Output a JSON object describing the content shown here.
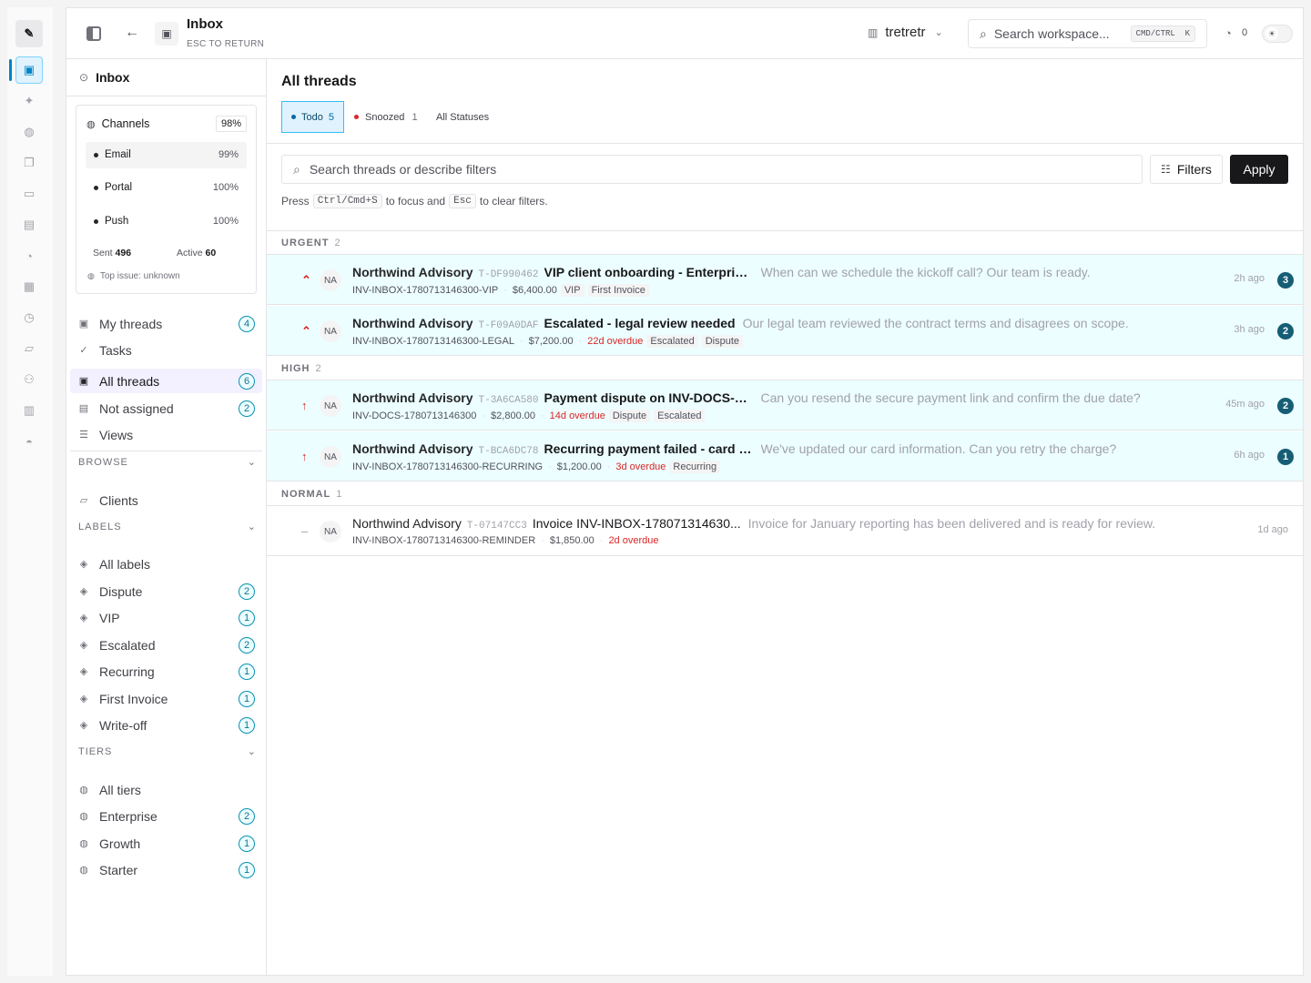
{
  "header": {
    "title": "Inbox",
    "subtitle": "ESC TO RETURN",
    "workspace": "tretretr",
    "search_placeholder": "Search workspace...",
    "shortcut": "CMD/CTRL  K",
    "notif_count": "0"
  },
  "sidebar": {
    "title": "Inbox",
    "channels": {
      "label": "Channels",
      "pct": "98%",
      "items": [
        {
          "label": "Email",
          "pct": "99%"
        },
        {
          "label": "Portal",
          "pct": "100%"
        },
        {
          "label": "Push",
          "pct": "100%"
        }
      ],
      "sent_label": "Sent",
      "sent": "496",
      "active_label": "Active",
      "active": "60",
      "top_issue": "Top issue: unknown"
    },
    "nav": [
      {
        "label": "My threads",
        "count": "4"
      },
      {
        "label": "Tasks",
        "count": ""
      },
      {
        "label": "All threads",
        "count": "6"
      },
      {
        "label": "Not assigned",
        "count": "2"
      },
      {
        "label": "Views",
        "count": ""
      }
    ],
    "browse": {
      "heading": "BROWSE",
      "items": [
        {
          "label": "Clients"
        }
      ]
    },
    "labels": {
      "heading": "LABELS",
      "items": [
        {
          "label": "All labels",
          "count": ""
        },
        {
          "label": "Dispute",
          "count": "2"
        },
        {
          "label": "VIP",
          "count": "1"
        },
        {
          "label": "Escalated",
          "count": "2"
        },
        {
          "label": "Recurring",
          "count": "1"
        },
        {
          "label": "First Invoice",
          "count": "1"
        },
        {
          "label": "Write-off",
          "count": "1"
        }
      ]
    },
    "tiers": {
      "heading": "TIERS",
      "items": [
        {
          "label": "All tiers",
          "count": ""
        },
        {
          "label": "Enterprise",
          "count": "2"
        },
        {
          "label": "Growth",
          "count": "1"
        },
        {
          "label": "Starter",
          "count": "1"
        }
      ]
    }
  },
  "main": {
    "title": "All threads",
    "tabs": [
      {
        "label": "Todo",
        "count": "5"
      },
      {
        "label": "Snoozed",
        "count": "1"
      },
      {
        "label": "All Statuses",
        "count": ""
      }
    ],
    "search_placeholder": "Search threads or describe filters",
    "filters_label": "Filters",
    "apply_label": "Apply",
    "hint": {
      "press": "Press",
      "k1": "Ctrl/Cmd+S",
      "mid": "to focus and",
      "k2": "Esc",
      "end": "to clear filters."
    },
    "groups": [
      {
        "label": "URGENT",
        "count": "2"
      },
      {
        "label": "HIGH",
        "count": "2"
      },
      {
        "label": "NORMAL",
        "count": "1"
      }
    ],
    "rows": [
      {
        "prio": "⌃",
        "avatar": "NA",
        "client": "Northwind Advisory",
        "tid": "T-DF990462",
        "subject": "VIP client onboarding - Enterprise...",
        "preview": "When can we schedule the kickoff call? Our team is ready.",
        "invoice": "INV-INBOX-1780713146300-VIP",
        "amount": "$6,400.00",
        "overdue": "",
        "tags": [
          "VIP",
          "First Invoice"
        ],
        "time": "2h ago",
        "badge": "3"
      },
      {
        "prio": "⌃",
        "avatar": "NA",
        "client": "Northwind Advisory",
        "tid": "T-F09A0DAF",
        "subject": "Escalated - legal review needed",
        "preview": "Our legal team reviewed the contract terms and disagrees on scope.",
        "invoice": "INV-INBOX-1780713146300-LEGAL",
        "amount": "$7,200.00",
        "overdue": "22d overdue",
        "tags": [
          "Escalated",
          "Dispute"
        ],
        "time": "3h ago",
        "badge": "2"
      },
      {
        "prio": "↑",
        "avatar": "NA",
        "client": "Northwind Advisory",
        "tid": "T-3A6CA580",
        "subject": "Payment dispute on INV-DOCS-17...",
        "preview": "Can you resend the secure payment link and confirm the due date?",
        "invoice": "INV-DOCS-1780713146300",
        "amount": "$2,800.00",
        "overdue": "14d overdue",
        "tags": [
          "Dispute",
          "Escalated"
        ],
        "time": "45m ago",
        "badge": "2"
      },
      {
        "prio": "↑",
        "avatar": "NA",
        "client": "Northwind Advisory",
        "tid": "T-BCA6DC78",
        "subject": "Recurring payment failed - card e...",
        "preview": "We've updated our card information. Can you retry the charge?",
        "invoice": "INV-INBOX-1780713146300-RECURRING",
        "amount": "$1,200.00",
        "overdue": "3d overdue",
        "tags": [
          "Recurring"
        ],
        "time": "6h ago",
        "badge": "1"
      },
      {
        "prio": "–",
        "avatar": "NA",
        "client": "Northwind Advisory",
        "tid": "T-07147CC3",
        "subject": "Invoice INV-INBOX-178071314630...",
        "preview": "Invoice for January reporting has been delivered and is ready for review.",
        "invoice": "INV-INBOX-1780713146300-REMINDER",
        "amount": "$1,850.00",
        "overdue": "2d overdue",
        "tags": [],
        "time": "1d ago",
        "badge": ""
      }
    ]
  },
  "colors": {
    "accent": "#0284c7",
    "badge": "#155e75",
    "overdue": "#dc2626",
    "highlight": "#ecfeff"
  }
}
